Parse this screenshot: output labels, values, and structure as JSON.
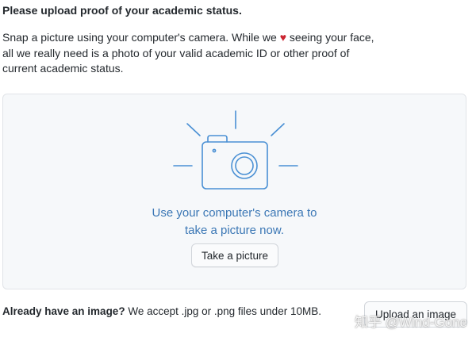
{
  "header": {
    "title": "Please upload proof of your academic status."
  },
  "description": {
    "before_heart": "Snap a picture using your computer's camera. While we ",
    "heart": "♥",
    "after_heart": " seeing your face, all we really need is a photo of your valid academic ID or other proof of current academic status."
  },
  "capture": {
    "icon": "camera-icon",
    "caption_line1": "Use your computer's camera to",
    "caption_line2": "take a picture now.",
    "take_picture_label": "Take a picture"
  },
  "footer": {
    "strong_text": "Already have an image?",
    "text": " We accept .jpg or .png files under 10MB.",
    "upload_label": "Upload an image"
  },
  "watermark": {
    "text": "知乎 @Wind-Gone"
  },
  "colors": {
    "accent_blue": "#3b77b5",
    "camera_blue": "#4a90d4",
    "heart_red": "#cb2431",
    "panel_bg": "#f6f8fa"
  }
}
